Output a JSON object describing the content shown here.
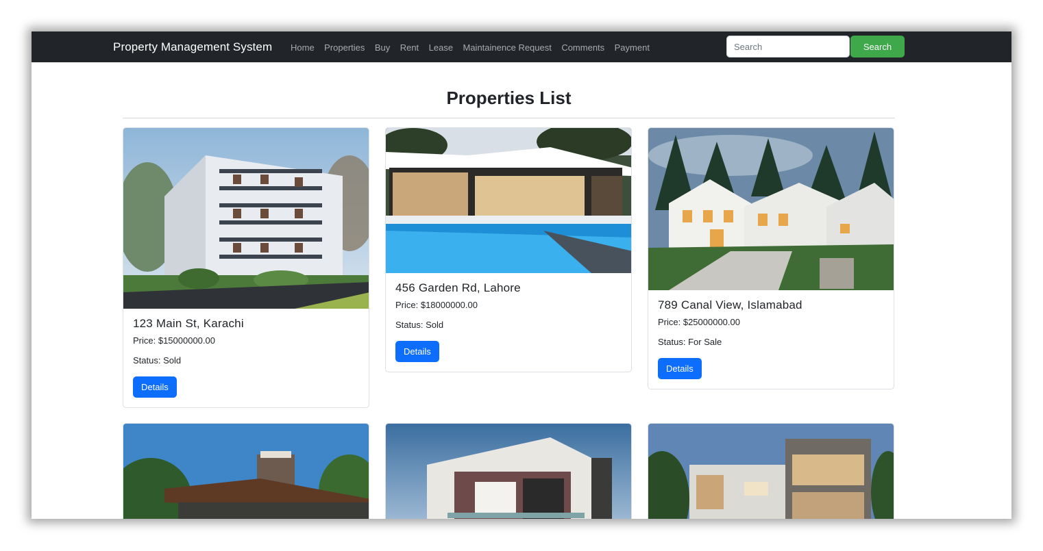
{
  "navbar": {
    "brand": "Property Management System",
    "links": [
      "Home",
      "Properties",
      "Buy",
      "Rent",
      "Lease",
      "Maintainence Request",
      "Comments",
      "Payment"
    ],
    "search_placeholder": "Search",
    "search_button": "Search",
    "colors": {
      "background": "#212529",
      "search_button": "#3ea84a"
    }
  },
  "page": {
    "title": "Properties List"
  },
  "properties": [
    {
      "address": "123 Main St, Karachi",
      "price": "Price: $15000000.00",
      "status": "Status: Sold",
      "button": "Details",
      "image": "apartment-building-photo"
    },
    {
      "address": "456 Garden Rd, Lahore",
      "price": "Price: $18000000.00",
      "status": "Status: Sold",
      "button": "Details",
      "image": "modern-house-with-pool-photo"
    },
    {
      "address": "789 Canal View, Islamabad",
      "price": "Price: $25000000.00",
      "status": "Status: For Sale",
      "button": "Details",
      "image": "colonial-mansion-photo"
    },
    {
      "image": "mountain-lodge-photo"
    },
    {
      "image": "modern-villa-photo"
    },
    {
      "image": "modern-apartment-photo"
    }
  ],
  "accent_color": "#0d6efd"
}
